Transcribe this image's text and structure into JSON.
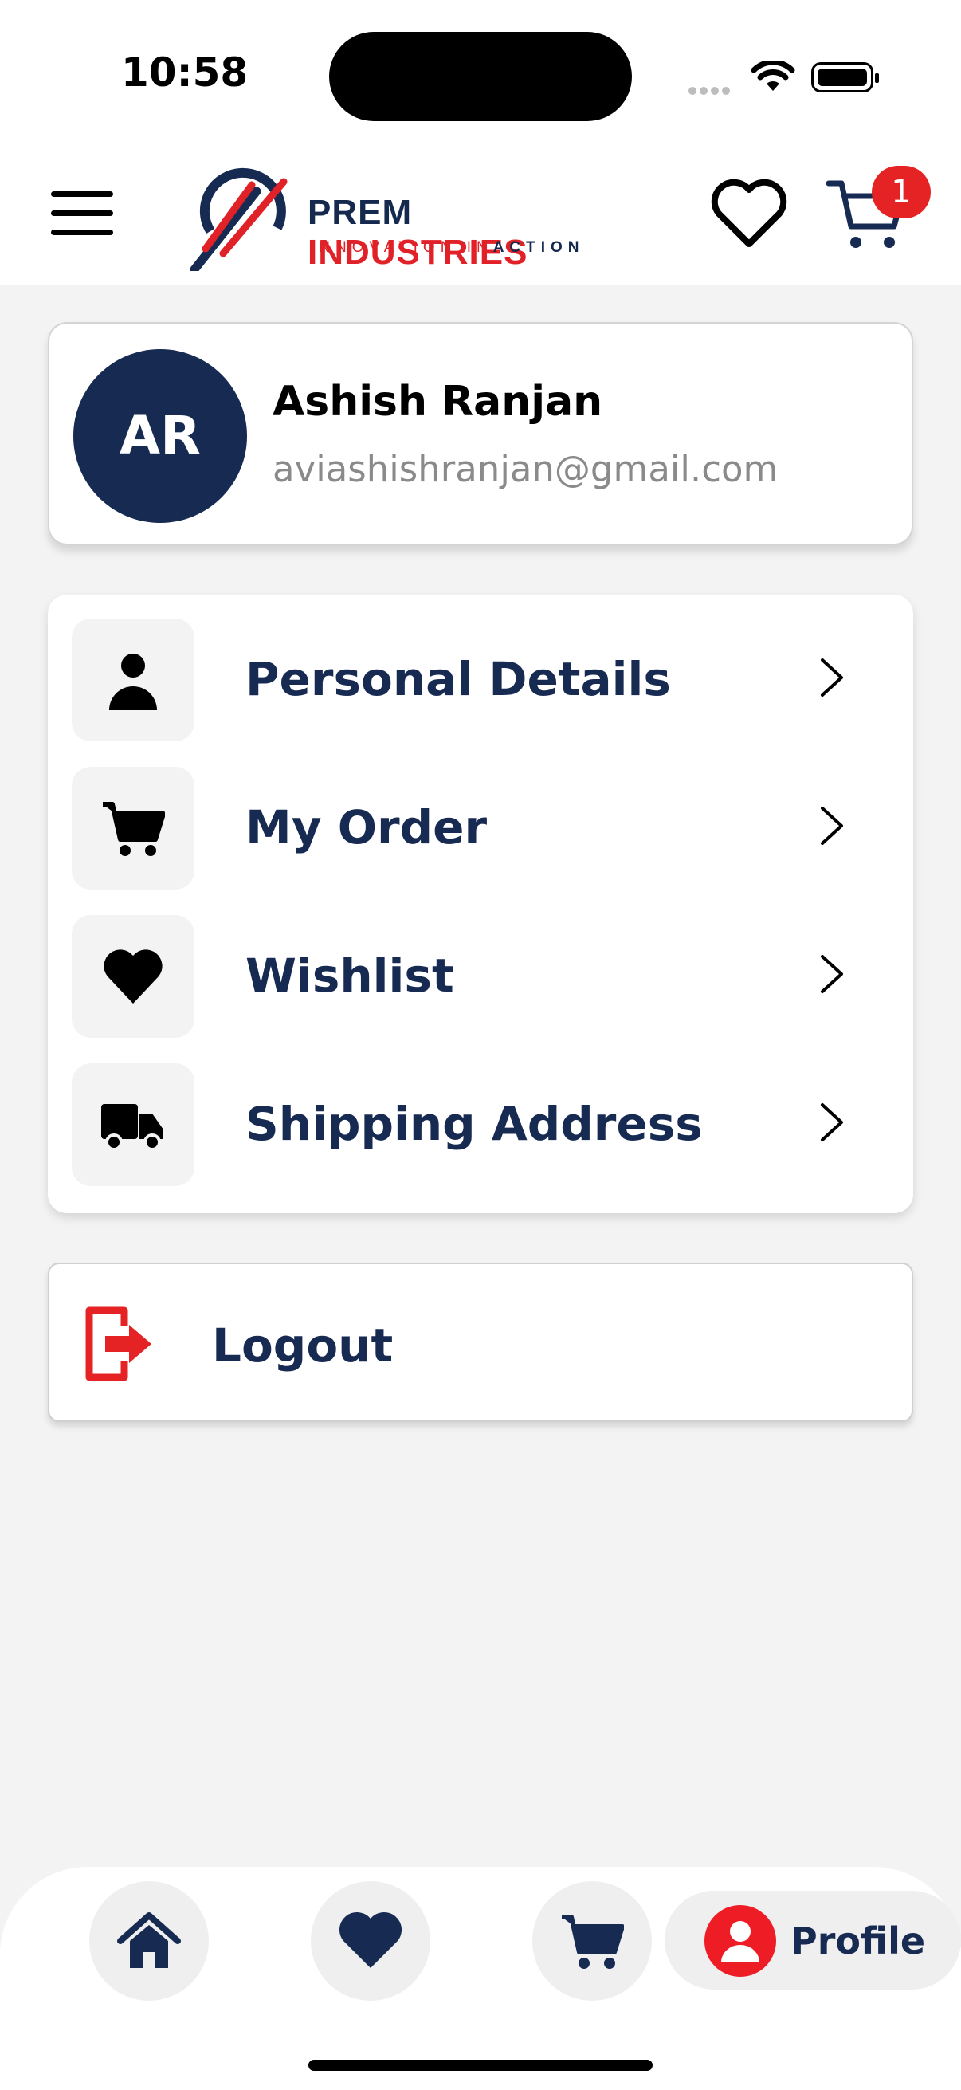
{
  "status_bar": {
    "time": "10:58"
  },
  "header": {
    "brand_name_part1": "PREM",
    "brand_name_part2": "INDUSTRIES",
    "tagline_part1": "INNOVATION",
    "tagline_part2": "IN",
    "tagline_part3": "ACTION",
    "cart_badge_count": "1"
  },
  "profile": {
    "initials": "AR",
    "name": "Ashish Ranjan",
    "email": "aviashishranjan@gmail.com"
  },
  "menu": {
    "items": [
      {
        "label": "Personal Details",
        "icon": "person-icon"
      },
      {
        "label": "My Order",
        "icon": "cart-icon"
      },
      {
        "label": "Wishlist",
        "icon": "heart-icon"
      },
      {
        "label": "Shipping Address",
        "icon": "truck-icon"
      }
    ]
  },
  "logout": {
    "label": "Logout"
  },
  "bottom_nav": {
    "items": [
      "home-icon",
      "heart-icon",
      "cart-icon"
    ],
    "active_label": "Profile"
  },
  "colors": {
    "navy": "#172a52",
    "red": "#e52325",
    "background": "#f3f3f3"
  }
}
